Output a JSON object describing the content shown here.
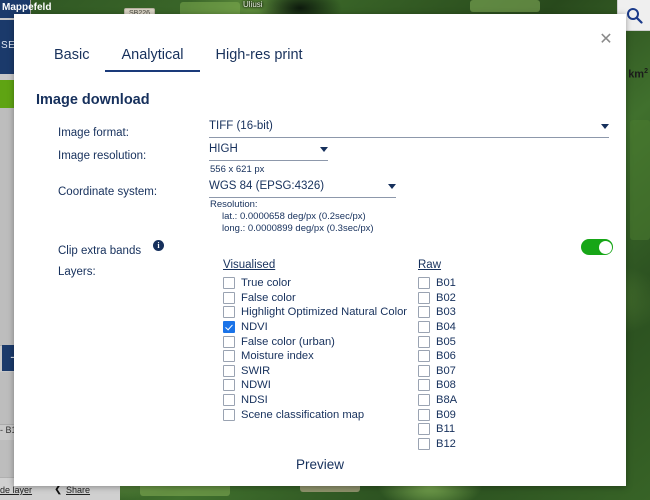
{
  "background": {
    "app_sidebar": {
      "title": "Mappefeld",
      "se_label": "SE",
      "plus_label": "+",
      "b1_label": "- B1"
    },
    "bottom_bar": {
      "hide_layer_label": "de layer",
      "share_label": "Share",
      "share_icon": "share-icon"
    },
    "search_icon": "search-icon",
    "scale_label": "km",
    "scale_superscript": "2",
    "map_chips": [
      "SB226"
    ],
    "map_labels": [
      "Uliusi"
    ]
  },
  "modal": {
    "close_icon": "close-icon",
    "tabs": [
      {
        "label": "Basic",
        "active": false
      },
      {
        "label": "Analytical",
        "active": true
      },
      {
        "label": "High-res print",
        "active": false
      }
    ],
    "section_title": "Image download",
    "fields": {
      "image_format": {
        "label": "Image format:",
        "value": "TIFF (16-bit)",
        "caret_icon": "chevron-down-icon"
      },
      "image_resolution": {
        "label": "Image resolution:",
        "value": "HIGH",
        "caret_icon": "chevron-down-icon",
        "helper": "556 x 621 px"
      },
      "coordinate_system": {
        "label": "Coordinate system:",
        "value": "WGS 84 (EPSG:4326)",
        "caret_icon": "chevron-down-icon",
        "helper_title": "Resolution:",
        "helper_lat": "lat.: 0.0000658 deg/px (0.2sec/px)",
        "helper_long": "long.: 0.0000899 deg/px (0.3sec/px)"
      },
      "clip_extra_bands": {
        "label": "Clip extra bands",
        "info_icon": "info-icon",
        "enabled": true
      },
      "layers": {
        "label": "Layers:"
      }
    },
    "visualised": {
      "heading": "Visualised",
      "items": [
        {
          "label": "True color",
          "checked": false
        },
        {
          "label": "False color",
          "checked": false
        },
        {
          "label": "Highlight Optimized Natural Color",
          "checked": false
        },
        {
          "label": "NDVI",
          "checked": true
        },
        {
          "label": "False color (urban)",
          "checked": false
        },
        {
          "label": "Moisture index",
          "checked": false
        },
        {
          "label": "SWIR",
          "checked": false
        },
        {
          "label": "NDWI",
          "checked": false
        },
        {
          "label": "NDSI",
          "checked": false
        },
        {
          "label": "Scene classification map",
          "checked": false
        }
      ]
    },
    "raw": {
      "heading": "Raw",
      "items": [
        {
          "label": "B01",
          "checked": false
        },
        {
          "label": "B02",
          "checked": false
        },
        {
          "label": "B03",
          "checked": false
        },
        {
          "label": "B04",
          "checked": false
        },
        {
          "label": "B05",
          "checked": false
        },
        {
          "label": "B06",
          "checked": false
        },
        {
          "label": "B07",
          "checked": false
        },
        {
          "label": "B08",
          "checked": false
        },
        {
          "label": "B8A",
          "checked": false
        },
        {
          "label": "B09",
          "checked": false
        },
        {
          "label": "B11",
          "checked": false
        },
        {
          "label": "B12",
          "checked": false
        }
      ]
    },
    "preview_label": "Preview"
  },
  "colors": {
    "accent": "#16305c",
    "tab_underline": "#1a3a7a",
    "toggle_on": "#17a617",
    "checkbox_checked": "#1a73e8",
    "sidebar_blue": "#1b3a6b",
    "sidebar_green": "#5fa413"
  }
}
